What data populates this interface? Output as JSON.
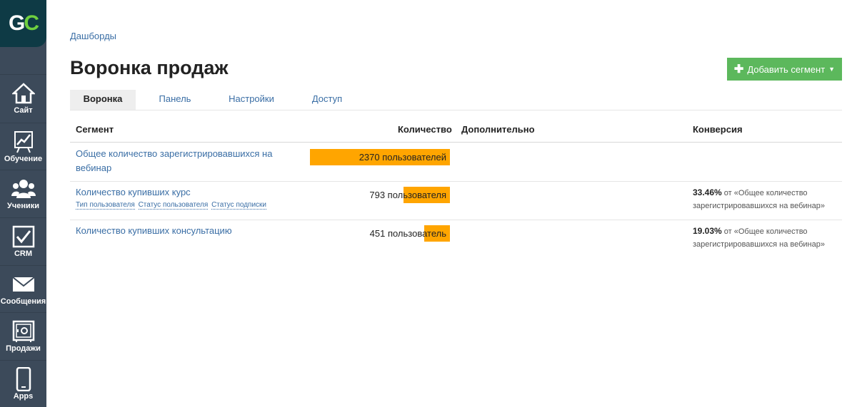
{
  "sidebar": {
    "logo_g": "G",
    "logo_c": "C",
    "items": [
      {
        "label": "Сайт",
        "icon": "home-icon"
      },
      {
        "label": "Обучение",
        "icon": "chart-board-icon"
      },
      {
        "label": "Ученики",
        "icon": "users-icon"
      },
      {
        "label": "CRM",
        "icon": "checkbox-icon"
      },
      {
        "label": "Сообщения",
        "icon": "envelope-icon"
      },
      {
        "label": "Продажи",
        "icon": "safe-icon"
      },
      {
        "label": "Apps",
        "icon": "phone-icon"
      }
    ]
  },
  "breadcrumb": "Дашборды",
  "title": "Воронка продаж",
  "add_button": "Добавить сегмент",
  "tabs": [
    "Воронка",
    "Панель",
    "Настройки",
    "Доступ"
  ],
  "columns": {
    "segment": "Сегмент",
    "count": "Количество",
    "extra": "Дополнительно",
    "conversion": "Конверсия"
  },
  "rows": [
    {
      "name": "Общее количество зарегистрировавшихся на вебинар",
      "count": "2370 пользователей",
      "bar_fraction": 1.0,
      "filters": [],
      "conv_pct": "",
      "conv_text": ""
    },
    {
      "name": "Количество купивших курс",
      "count": "793 пользователя",
      "bar_fraction": 0.3346,
      "filters": [
        "Тип пользователя",
        "Статус пользователя",
        "Статус подписки"
      ],
      "conv_pct": "33.46%",
      "conv_text": "от «Общее количество зарегистрировавшихся на вебинар»"
    },
    {
      "name": "Количество купивших консультацию",
      "count": "451 пользователь",
      "bar_fraction": 0.1903,
      "filters": [],
      "conv_pct": "19.03%",
      "conv_text": "от «Общее количество зарегистрировавшихся на вебинар»"
    }
  ],
  "colors": {
    "sidebar_bg": "#3c4a5a",
    "accent_green": "#5cb85c",
    "bar_orange": "#ffa500",
    "link_blue": "#3a6ea5"
  }
}
